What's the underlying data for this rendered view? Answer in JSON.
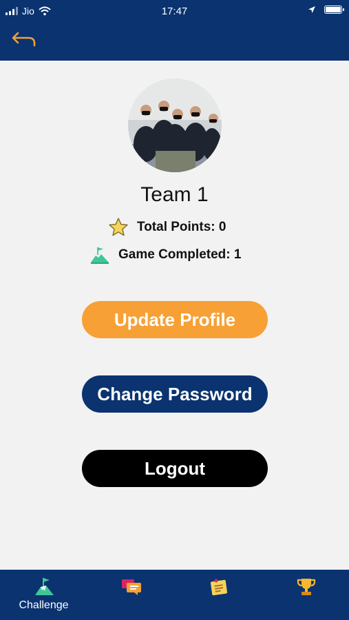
{
  "status": {
    "carrier": "Jio",
    "time": "17:47"
  },
  "profile": {
    "team_name": "Team 1",
    "total_points": "Total Points: 0",
    "games_completed": "Game Completed: 1"
  },
  "buttons": {
    "update_profile": "Update Profile",
    "change_password": "Change Password",
    "logout": "Logout"
  },
  "tabs": [
    {
      "label": "Challenge",
      "icon": "mountain-flag-icon",
      "active": true
    },
    {
      "label": "",
      "icon": "chat-icon",
      "active": false
    },
    {
      "label": "",
      "icon": "notes-icon",
      "active": false
    },
    {
      "label": "",
      "icon": "trophy-icon",
      "active": false
    }
  ],
  "colors": {
    "header": "#0a3370",
    "accent_orange": "#f7a035",
    "logout": "#000000",
    "background": "#f2f2f2"
  }
}
